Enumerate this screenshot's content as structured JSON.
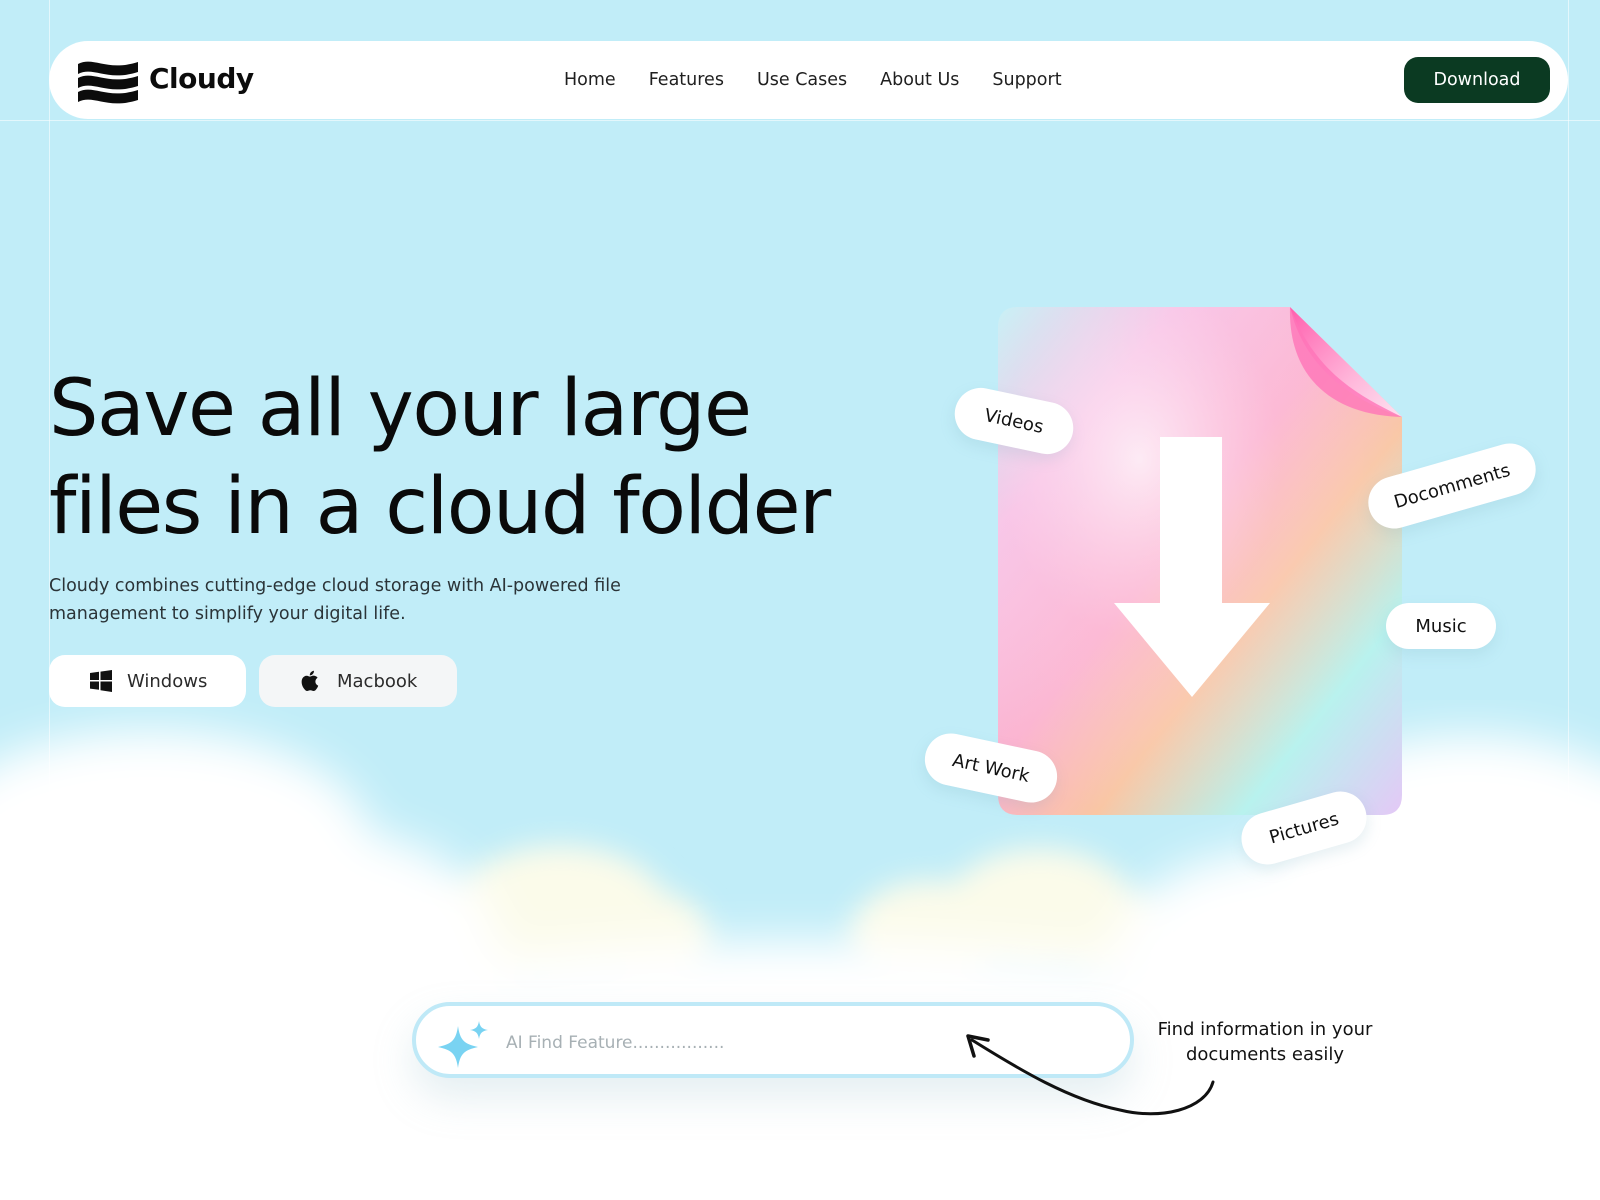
{
  "brand": {
    "name": "Cloudy",
    "logo_icon": "wave-logo-icon"
  },
  "nav": {
    "items": [
      {
        "label": "Home"
      },
      {
        "label": "Features"
      },
      {
        "label": "Use Cases"
      },
      {
        "label": "About Us"
      },
      {
        "label": "Support"
      }
    ],
    "download_label": "Download"
  },
  "hero": {
    "headline_line1": "Save all your large",
    "headline_line2": "files in a cloud folder",
    "subtitle": "Cloudy combines cutting-edge cloud storage with AI-powered file management to simplify your digital life.",
    "buttons": {
      "windows": {
        "label": "Windows",
        "icon": "windows-icon"
      },
      "macbook": {
        "label": "Macbook",
        "icon": "apple-icon"
      }
    }
  },
  "file_tags": {
    "videos": "Videos",
    "documents": "Docomments",
    "music": "Music",
    "artwork": "Art Work",
    "pictures": "Pictures"
  },
  "search": {
    "placeholder": "AI Find Feature.................",
    "icon": "sparkle-icon"
  },
  "hint": {
    "line1": "Find information in your",
    "line2": "documents easily"
  },
  "colors": {
    "background": "#c1edf8",
    "download_button": "#0b3a22",
    "search_border": "#bfe9f7",
    "sparkle": "#79d3f2"
  }
}
